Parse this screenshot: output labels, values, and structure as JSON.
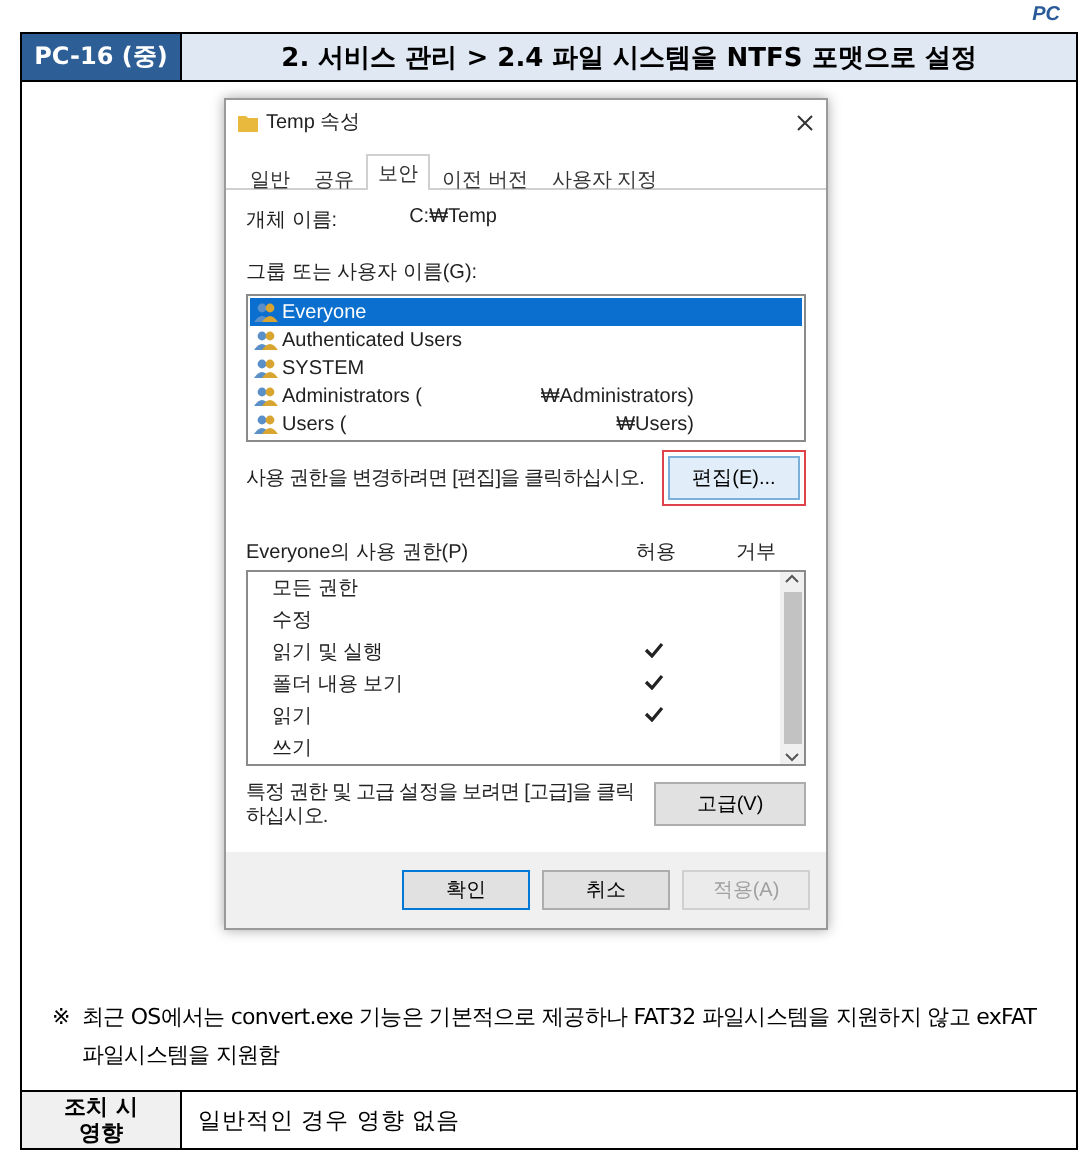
{
  "page_label": "PC",
  "header": {
    "code": "PC-16 (중)",
    "title": "2. 서비스 관리 > 2.4 파일 시스템을 NTFS 포맷으로 설정"
  },
  "dialog": {
    "title": "Temp 속성",
    "tabs": [
      {
        "label": "일반",
        "selected": false
      },
      {
        "label": "공유",
        "selected": false
      },
      {
        "label": "보안",
        "selected": true
      },
      {
        "label": "이전 버전",
        "selected": false
      },
      {
        "label": "사용자 지정",
        "selected": false
      }
    ],
    "object_name_label": "개체 이름:",
    "object_name_value": "C:₩Temp",
    "group_label": "그룹 또는 사용자 이름(G):",
    "users": [
      {
        "name": "Everyone",
        "selected": true
      },
      {
        "name": "Authenticated Users",
        "selected": false
      },
      {
        "name": "SYSTEM",
        "selected": false
      },
      {
        "name": "Administrators (",
        "suffix": "₩Administrators)",
        "selected": false
      },
      {
        "name": "Users (",
        "suffix": "₩Users)",
        "selected": false
      }
    ],
    "edit_hint": "사용 권한을 변경하려면 [편집]을 클릭하십시오.",
    "edit_button": {
      "label": "편집(E)...",
      "highlighted": true
    },
    "permissions_label": "Everyone의 사용 권한(P)",
    "allow_header": "허용",
    "deny_header": "거부",
    "permissions": [
      {
        "name": "모든 권한",
        "allow": false,
        "deny": false
      },
      {
        "name": "수정",
        "allow": false,
        "deny": false
      },
      {
        "name": "읽기 및 실행",
        "allow": true,
        "deny": false
      },
      {
        "name": "폴더 내용 보기",
        "allow": true,
        "deny": false
      },
      {
        "name": "읽기",
        "allow": true,
        "deny": false
      },
      {
        "name": "쓰기",
        "allow": false,
        "deny": false
      }
    ],
    "advanced_hint": "특정 권한 및 고급 설정을 보려면 [고급]을 클릭하십시오.",
    "advanced_button": "고급(V)",
    "buttons": [
      {
        "label": "확인",
        "disabled": false
      },
      {
        "label": "취소",
        "disabled": false
      },
      {
        "label": "적용(A)",
        "disabled": true
      }
    ]
  },
  "note": {
    "mark": "※",
    "text": "최근 OS에서는 convert.exe 기능은 기본적으로 제공하나 FAT32 파일시스템을 지원하지 않고 exFAT 파일시스템을 지원함"
  },
  "footer": {
    "label": "조치 시 영향",
    "value": "일반적인 경우 영향 없음"
  }
}
